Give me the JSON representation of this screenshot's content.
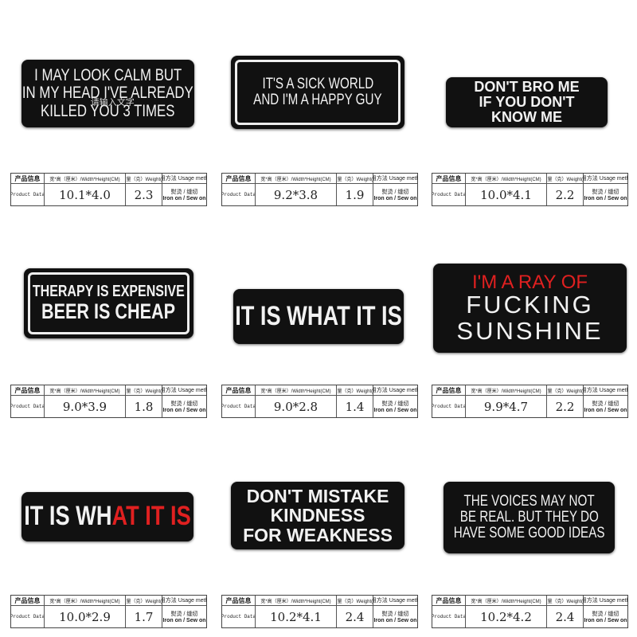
{
  "table_labels": {
    "product_info_cn": "产品信息",
    "product_data": "Product Data",
    "size_header": "宽*高（厘米）/Width*Height(CM)",
    "weight_header": "重量（克）Weight(g)",
    "usage_header": "使用方法 Usage method",
    "usage_cn": "熨烫 / 缝纫",
    "usage_en": "Iron on / Sew on"
  },
  "watermark": "请输入文字",
  "colors": {
    "patch": "#111111",
    "accent_red": "#e02020"
  },
  "products": [
    {
      "lines": [
        "I MAY LOOK CALM BUT",
        "IN MY HEAD I'VE ALREADY",
        "KILLED YOU 3 TIMES"
      ],
      "size": "10.1*4.0",
      "weight": "2.3"
    },
    {
      "lines": [
        "IT'S A SICK WORLD",
        "AND I'M A HAPPY GUY"
      ],
      "size": "9.2*3.8",
      "weight": "1.9"
    },
    {
      "lines": [
        "DON'T BRO ME",
        "IF YOU DON'T",
        "KNOW ME"
      ],
      "size": "10.0*4.1",
      "weight": "2.2"
    },
    {
      "lines": [
        "THERAPY IS EXPENSIVE",
        "BEER IS CHEAP"
      ],
      "size": "9.0*3.9",
      "weight": "1.8"
    },
    {
      "lines": [
        "IT IS WHAT IT IS"
      ],
      "size": "9.0*2.8",
      "weight": "1.4"
    },
    {
      "lines": [
        "I'M A RAY OF",
        "FUCKING",
        "SUNSHINE"
      ],
      "size": "9.9*4.7",
      "weight": "2.2"
    },
    {
      "lines": [
        "IT IS WH",
        "AT IT IS"
      ],
      "size": "10.0*2.9",
      "weight": "1.7"
    },
    {
      "lines": [
        "DON'T MISTAKE",
        "KINDNESS",
        "FOR WEAKNESS"
      ],
      "size": "10.2*4.1",
      "weight": "2.4"
    },
    {
      "lines": [
        "THE VOICES MAY NOT",
        "BE REAL. BUT THEY DO",
        "HAVE SOME GOOD IDEAS"
      ],
      "size": "10.2*4.2",
      "weight": "2.4"
    }
  ]
}
